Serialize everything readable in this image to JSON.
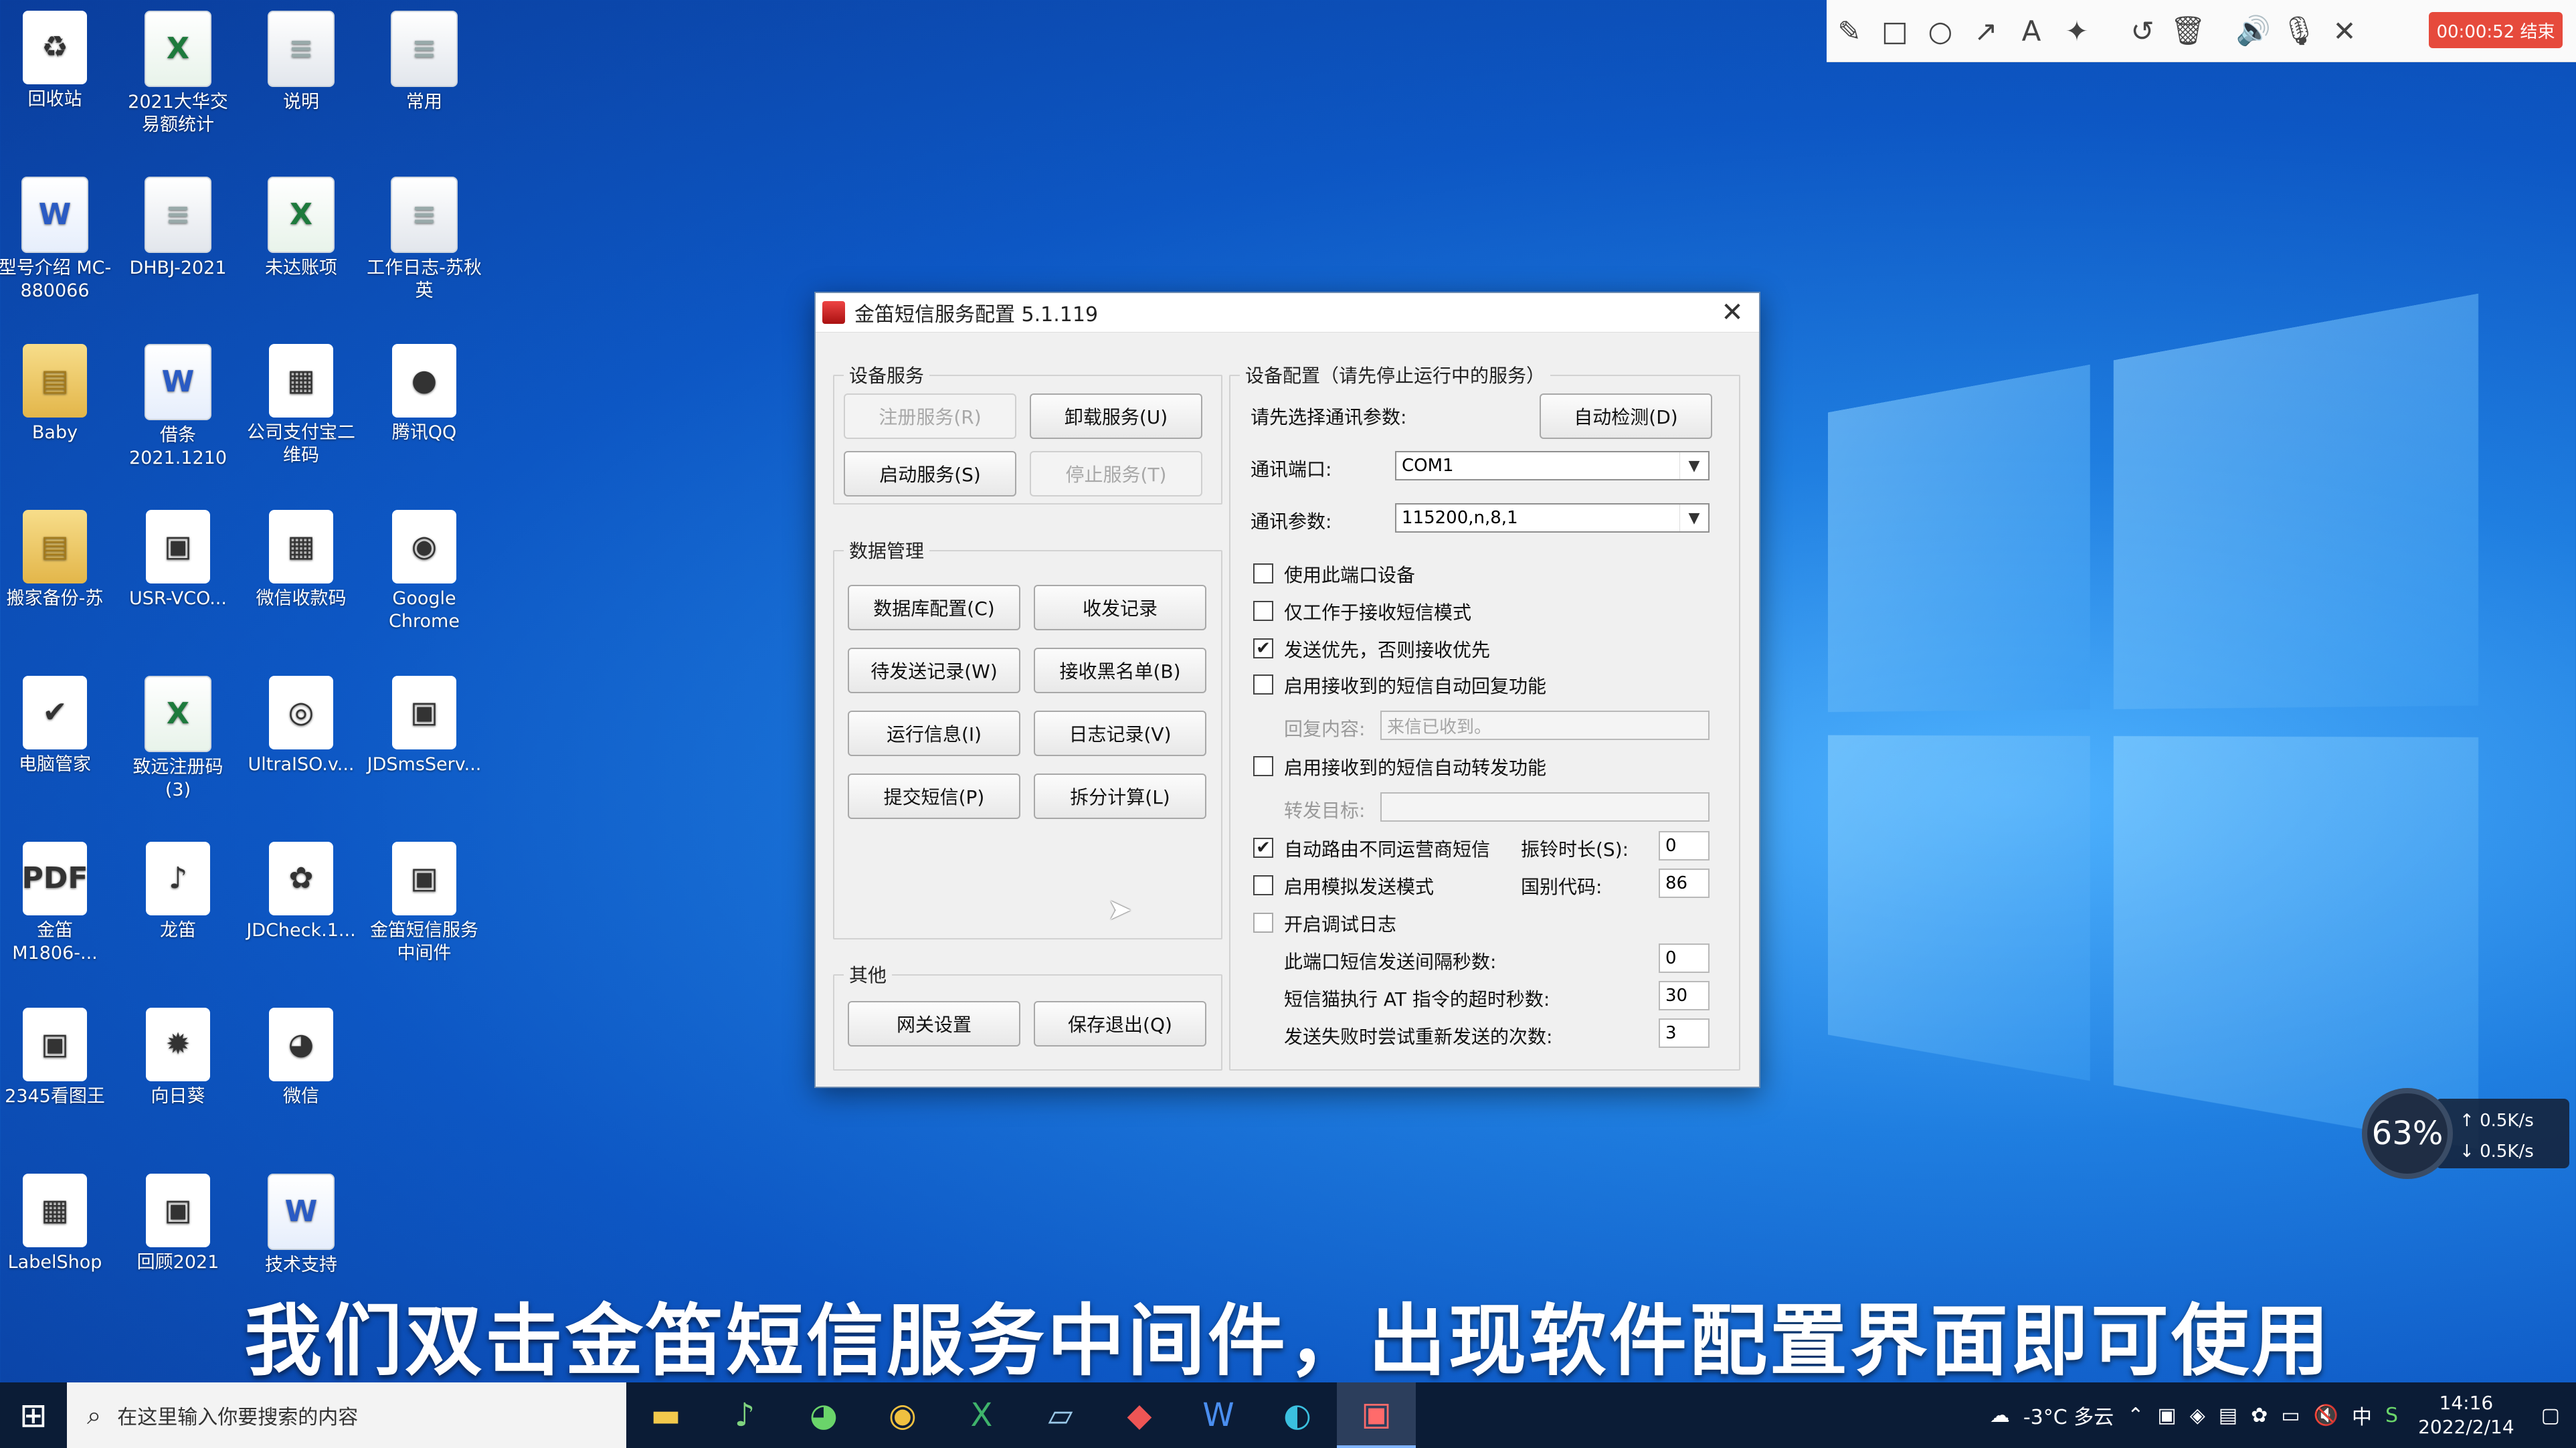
{
  "desktop_icons": [
    {
      "label": "回收站",
      "glyph": "♻"
    },
    {
      "label": "2021大华交易额统计",
      "glyph": "X"
    },
    {
      "label": "说明",
      "glyph": "≡"
    },
    {
      "label": "常用",
      "glyph": "≡"
    },
    {
      "label": "型号介绍 MC-880066",
      "glyph": "W"
    },
    {
      "label": "DHBJ-2021",
      "glyph": "≡"
    },
    {
      "label": "未达账项",
      "glyph": "X"
    },
    {
      "label": "工作日志-苏秋英",
      "glyph": "≡"
    },
    {
      "label": "Baby",
      "glyph": "▤"
    },
    {
      "label": "借条 2021.1210",
      "glyph": "W"
    },
    {
      "label": "公司支付宝二维码",
      "glyph": "▦"
    },
    {
      "label": "腾讯QQ",
      "glyph": "●"
    },
    {
      "label": "搬家备份-苏",
      "glyph": "▤"
    },
    {
      "label": "USR-VCO...",
      "glyph": "▣"
    },
    {
      "label": "微信收款码",
      "glyph": "▦"
    },
    {
      "label": "Google Chrome",
      "glyph": "◉"
    },
    {
      "label": "电脑管家",
      "glyph": "✔"
    },
    {
      "label": "致远注册码 (3)",
      "glyph": "X"
    },
    {
      "label": "UltraISO.v...",
      "glyph": "◎"
    },
    {
      "label": "JDSmsServ...",
      "glyph": "▣"
    },
    {
      "label": "金笛 M1806-...",
      "glyph": "PDF"
    },
    {
      "label": "龙笛",
      "glyph": "♪"
    },
    {
      "label": "JDCheck.1...",
      "glyph": "✿"
    },
    {
      "label": "金笛短信服务中间件",
      "glyph": "▣"
    },
    {
      "label": "2345看图王",
      "glyph": "▣"
    },
    {
      "label": "向日葵",
      "glyph": "✹"
    },
    {
      "label": "微信",
      "glyph": "◕"
    },
    {
      "label": "LabelShop",
      "glyph": "▦"
    },
    {
      "label": "回顾2021",
      "glyph": "▣"
    },
    {
      "label": "技术支持",
      "glyph": "W"
    }
  ],
  "annot_toolbar": {
    "tools": [
      "pencil-icon",
      "rect-icon",
      "circle-icon",
      "arrow-icon",
      "text-icon",
      "magic-icon",
      "undo-icon",
      "trash-icon",
      "speaker-icon",
      "mic-muted-icon",
      "close-icon"
    ],
    "glyphs": [
      "✎",
      "□",
      "○",
      "↗",
      "A",
      "✦",
      "↺",
      "🗑",
      "🔊",
      "🎙",
      "✕"
    ],
    "record_label": "00:00:52 结束"
  },
  "dialog": {
    "title": "金笛短信服务配置 5.1.119",
    "device_service": {
      "legend": "设备服务",
      "register": "注册服务(R)",
      "uninstall": "卸载服务(U)",
      "start": "启动服务(S)",
      "stop": "停止服务(T)"
    },
    "data_mgmt": {
      "legend": "数据管理",
      "db_config": "数据库配置(C)",
      "send_recv": "收发记录",
      "pending": "待发送记录(W)",
      "blacklist": "接收黑名单(B)",
      "run_info": "运行信息(I)",
      "log": "日志记录(V)",
      "submit_sms": "提交短信(P)",
      "split_calc": "拆分计算(L)"
    },
    "other": {
      "legend": "其他",
      "gateway": "网关设置",
      "save_exit": "保存退出(Q)"
    },
    "device_config": {
      "legend": "设备配置（请先停止运行中的服务）",
      "select_param_label": "请先选择通讯参数:",
      "auto_detect": "自动检测(D)",
      "port_label": "通讯端口:",
      "port_value": "COM1",
      "param_label": "通讯参数:",
      "param_value": "115200,n,8,1",
      "use_port": "使用此端口设备",
      "recv_only": "仅工作于接收短信模式",
      "send_priority": "发送优先，否则接收优先",
      "auto_reply": "启用接收到的短信自动回复功能",
      "reply_label": "回复内容:",
      "reply_value": "来信已收到。",
      "auto_forward": "启用接收到的短信自动转发功能",
      "forward_label": "转发目标:",
      "forward_value": "",
      "auto_route": "自动路由不同运营商短信",
      "ring_label": "振铃时长(S):",
      "ring_value": "0",
      "sim_mode": "启用模拟发送模式",
      "country_label": "国别代码:",
      "country_value": "86",
      "debug_log": "开启调试日志",
      "interval_label": "此端口短信发送间隔秒数:",
      "interval_value": "0",
      "timeout_label": "短信猫执行 AT 指令的超时秒数:",
      "timeout_value": "30",
      "retry_label": "发送失败时尝试重新发送的次数:",
      "retry_value": "3"
    }
  },
  "subtitle": "我们双击金笛短信服务中间件，出现软件配置界面即可使用",
  "net_widget": {
    "percent": "63%",
    "up": "0.5K/s",
    "down": "0.5K/s"
  },
  "taskbar": {
    "search_placeholder": "在这里输入你要搜索的内容",
    "weather": "-3°C 多云",
    "time": "14:16",
    "date": "2022/2/14",
    "ime": "中"
  }
}
